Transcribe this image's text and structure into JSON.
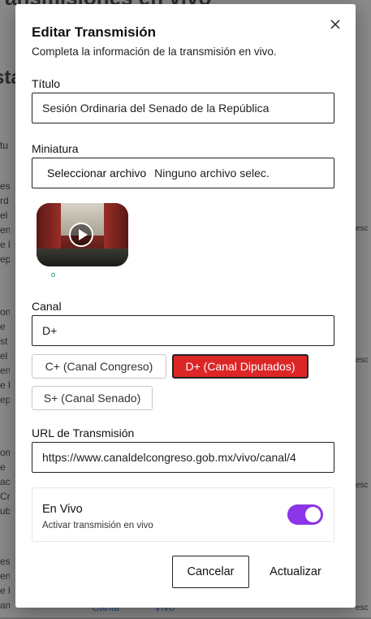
{
  "background": {
    "title": "ansmisiones en vivo",
    "heading": "sta",
    "bottom_link_1": "Canal",
    "bottom_link_2": "Vivo"
  },
  "modal": {
    "title": "Editar Transmisión",
    "subtitle": "Completa la información de la transmisión en vivo.",
    "close_icon": "close-icon",
    "fields": {
      "titulo_label": "Título",
      "titulo_value": "Sesión Ordinaria del Senado de la República",
      "miniatura_label": "Miniatura",
      "file_button": "Seleccionar archivo",
      "file_status": "Ninguno archivo selec.",
      "canal_label": "Canal",
      "canal_value": "D+",
      "url_label": "URL de Transmisión",
      "url_value": "https://www.canaldelcongreso.gob.mx/vivo/canal/4"
    },
    "channel_options": [
      "C+ (Canal Congreso)",
      "D+ (Canal Diputados)",
      "S+ (Canal Senado)"
    ],
    "selected_channel": "D+ (Canal Diputados)",
    "live": {
      "title": "En Vivo",
      "description": "Activar transmisión en vivo",
      "enabled": true,
      "toggle_color": "#8b34e8"
    },
    "buttons": {
      "cancel": "Cancelar",
      "update": "Actualizar"
    },
    "accent_color": "#dc2626"
  }
}
